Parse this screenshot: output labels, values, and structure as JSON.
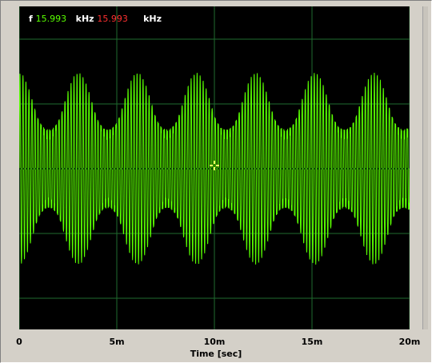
{
  "readout": {
    "prefix": "f",
    "value1": "15.993",
    "unit1": "kHz",
    "value2": "15.993",
    "unit2": "kHz"
  },
  "colors": {
    "trace": "#59ff00",
    "grid": "#1f6b2f",
    "background": "#000000",
    "cursor": "#ffff66",
    "value1_color": "#59ff00",
    "value2_color": "#ff3030"
  },
  "chart_data": {
    "type": "line",
    "title": "",
    "xlabel": "Time [sec]",
    "ylabel": "",
    "xlim": [
      0,
      0.02
    ],
    "tick_labels": [
      "0",
      "5m",
      "10m",
      "15m",
      "20m"
    ],
    "grid": true,
    "series": [
      {
        "frequency_hz": 15993,
        "description": "modulated oscillating signal"
      }
    ]
  }
}
